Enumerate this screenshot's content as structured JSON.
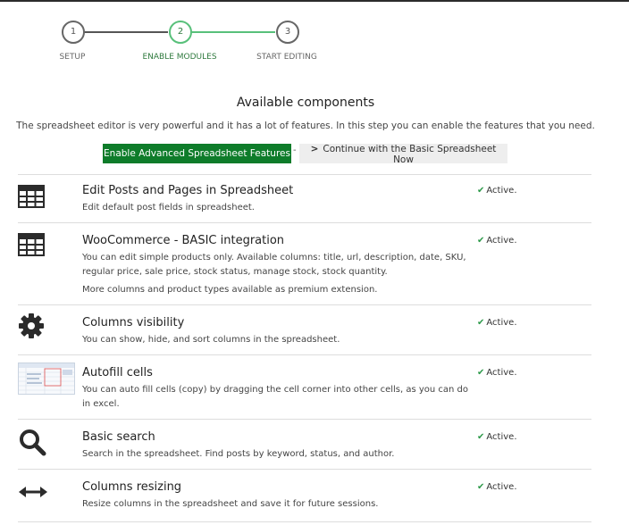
{
  "steps": [
    {
      "number": "1",
      "label": "SETUP"
    },
    {
      "number": "2",
      "label": "ENABLE MODULES"
    },
    {
      "number": "3",
      "label": "START EDITING"
    }
  ],
  "heading": {
    "title": "Available components",
    "subtitle": "The spreadsheet editor is very powerful and it has a lot of features. In this step you can enable the features that you need."
  },
  "actions": {
    "enable_label": "Enable Advanced Spreadsheet Features",
    "separator": "-",
    "basic_label": "Continue with the Basic Spreadsheet Now"
  },
  "modules": [
    {
      "icon": "table-grid-icon",
      "title": "Edit Posts and Pages in Spreadsheet",
      "description": "Edit default post fields in spreadsheet.",
      "status": "Active."
    },
    {
      "icon": "table-grid-icon",
      "title": "WooCommerce - BASIC integration",
      "description": "You can edit simple products only. Available columns: title, url, description, date, SKU, regular price, sale price, stock status, manage stock, stock quantity.",
      "description_extra": "More columns and product types available as premium extension.",
      "status": "Active."
    },
    {
      "icon": "gear-icon",
      "title": "Columns visibility",
      "description": "You can show, hide, and sort columns in the spreadsheet.",
      "status": "Active."
    },
    {
      "icon": "autofill-thumbnail",
      "title": "Autofill cells",
      "description": "You can auto fill cells (copy) by dragging the cell corner into other cells, as you can do in excel.",
      "status": "Active."
    },
    {
      "icon": "search-icon",
      "title": "Basic search",
      "description": "Search in the spreadsheet. Find posts by keyword, status, and author.",
      "status": "Active."
    },
    {
      "icon": "resize-arrows-icon",
      "title": "Columns resizing",
      "description": "Resize columns in the spreadsheet and save it for future sessions.",
      "status": "Active."
    }
  ],
  "colors": {
    "enable_button": "#0e7c2a",
    "active_step": "#58c07a",
    "check": "#2d9a4a"
  }
}
